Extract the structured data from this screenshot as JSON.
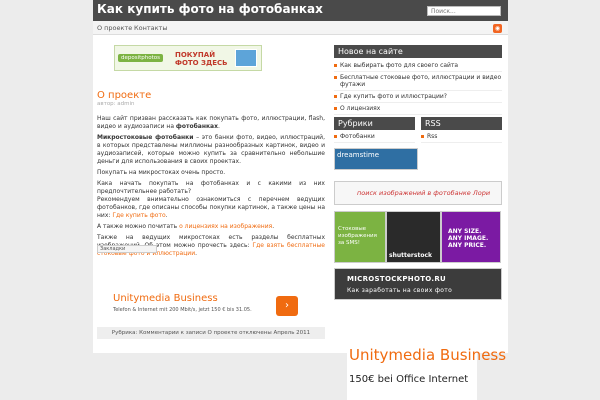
{
  "header": {
    "title": "Как купить фото на фотобанках",
    "search_placeholder": "Поиск..."
  },
  "nav": {
    "items": [
      "О проекте",
      "Контакты"
    ],
    "rss_icon": "rss-icon"
  },
  "top_banner": {
    "logo": "depositphotos",
    "text": "ПОКУПАЙ ФОТО ЗДЕСЬ"
  },
  "post": {
    "title": "О проекте",
    "meta": "автор: admin",
    "p1_a": "Наш сайт призван рассказать как покупать фото, иллюстрации, flash, видео и аудиозаписи на ",
    "p1_bold": "фотобанках",
    "p1_b": ".",
    "p2_bold": "Микростоковые фотобанки",
    "p2_rest": " – это банки фото, видео, иллюстраций, в которых представлены миллионы разнообразных картинок, видео и аудиозаписей, которые можно купить за сравнительно небольшие деньги для использования в своих проектах.",
    "p3": "Покупать на микростоках очень просто.",
    "p4": "Кака начать покупать на фотобанках и с какими из них предпочтительнее работать?",
    "p5_a": "Рекомендуем внимательно ознакомиться с перечнем ведущих фотобанков, где описаны способы покупки картинок, а также цены на них: ",
    "p5_link": "Где купить фото",
    "p5_b": ".",
    "p6_a": "А также можно почитать ",
    "p6_link": "о лицензиях на изображения",
    "p6_b": ".",
    "p7_a": "Также на ведущих микростоках есть разделы бесплатных изображений. Об этом можно прочесть здесь: ",
    "p7_link": "Где взять бесплатные стоковые фото и иллюстрации",
    "p7_b": ".",
    "bookmark": "Закладки"
  },
  "ad_inline": {
    "title": "Unitymedia Business",
    "sub": "Telefon & Internet mit 200 Mbit/s, jetzt 150 € bis 31.05.",
    "arrow": "›"
  },
  "post_footer": "Рубрика: Комментарии к записи О проекте отключены Апрель 2011",
  "sidebar": {
    "new_title": "Новое на сайте",
    "new_items": [
      "Как выбирать фото для своего сайта",
      "Бесплатные стоковые фото, иллюстрации и видео футажи",
      "Где купить фото и иллюстрации?",
      "О лицензиях"
    ],
    "rubrics_title": "Рубрики",
    "rubrics_items": [
      "Фотобанки"
    ],
    "rss_title": "RSS",
    "rss_items": [
      "Rss"
    ]
  },
  "side_banners": {
    "dreamstime": "dreamstime",
    "lori": "поиск изображений в фотобанке Лори",
    "depositphotos": "Стоковые изображения за SMS!",
    "shutterstock": "shutterstock",
    "any": "ANY SIZE. ANY IMAGE. ANY PRICE.",
    "micro_1": "MICROSTOCKPHOTO.RU",
    "micro_2": "Как заработать на своих фото"
  },
  "ad_bottom": {
    "title": "Unitymedia Business",
    "sub": "150€ bei Office Internet"
  },
  "colors": {
    "header_bg": "#4a4a4a",
    "accent": "#f06b10",
    "page_bg": "#ececec"
  }
}
